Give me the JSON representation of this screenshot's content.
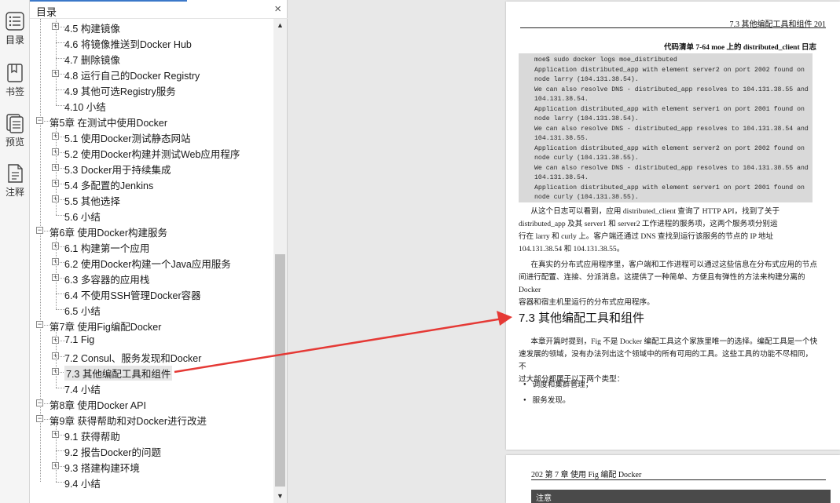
{
  "rail": {
    "items": [
      {
        "label": "目录",
        "icon": "toc-list-icon"
      },
      {
        "label": "书签",
        "icon": "bookmark-icon"
      },
      {
        "label": "预览",
        "icon": "preview-pages-icon"
      },
      {
        "label": "注释",
        "icon": "annotation-icon"
      }
    ]
  },
  "toc": {
    "title": "目录",
    "close": "×",
    "items": [
      {
        "text": "4.5 构建镜像",
        "level": 2,
        "expandable": true
      },
      {
        "text": "4.6 将镜像推送到Docker Hub",
        "level": 2,
        "expandable": false
      },
      {
        "text": "4.7 删除镜像",
        "level": 2,
        "expandable": false
      },
      {
        "text": "4.8 运行自己的Docker Registry",
        "level": 2,
        "expandable": true
      },
      {
        "text": "4.9 其他可选Registry服务",
        "level": 2,
        "expandable": false
      },
      {
        "text": "4.10 小结",
        "level": 2,
        "expandable": false
      },
      {
        "text": "第5章 在测试中使用Docker",
        "level": 1,
        "expandable": true
      },
      {
        "text": "5.1 使用Docker测试静态网站",
        "level": 2,
        "expandable": true
      },
      {
        "text": "5.2 使用Docker构建并测试Web应用程序",
        "level": 2,
        "expandable": true
      },
      {
        "text": "5.3 Docker用于持续集成",
        "level": 2,
        "expandable": true
      },
      {
        "text": "5.4 多配置的Jenkins",
        "level": 2,
        "expandable": true
      },
      {
        "text": "5.5 其他选择",
        "level": 2,
        "expandable": true
      },
      {
        "text": "5.6 小结",
        "level": 2,
        "expandable": false
      },
      {
        "text": "第6章 使用Docker构建服务",
        "level": 1,
        "expandable": true
      },
      {
        "text": "6.1 构建第一个应用",
        "level": 2,
        "expandable": true
      },
      {
        "text": "6.2 使用Docker构建一个Java应用服务",
        "level": 2,
        "expandable": true
      },
      {
        "text": "6.3 多容器的应用栈",
        "level": 2,
        "expandable": true
      },
      {
        "text": "6.4 不使用SSH管理Docker容器",
        "level": 2,
        "expandable": false
      },
      {
        "text": "6.5 小结",
        "level": 2,
        "expandable": false
      },
      {
        "text": "第7章 使用Fig编配Docker",
        "level": 1,
        "expandable": true
      },
      {
        "text": "7.1 Fig",
        "level": 2,
        "expandable": true
      },
      {
        "text": "7.2 Consul、服务发现和Docker",
        "level": 2,
        "expandable": true
      },
      {
        "text": "7.3 其他编配工具和组件",
        "level": 2,
        "expandable": true,
        "selected": true
      },
      {
        "text": "7.4 小结",
        "level": 2,
        "expandable": false
      },
      {
        "text": "第8章 使用Docker API",
        "level": 1,
        "expandable": true
      },
      {
        "text": "第9章 获得帮助和对Docker进行改进",
        "level": 1,
        "expandable": true
      },
      {
        "text": "9.1 获得帮助",
        "level": 2,
        "expandable": true
      },
      {
        "text": "9.2 报告Docker的问题",
        "level": 2,
        "expandable": false
      },
      {
        "text": "9.3 搭建构建环境",
        "level": 2,
        "expandable": true
      },
      {
        "text": "9.4 小结",
        "level": 2,
        "expandable": false
      }
    ]
  },
  "doc": {
    "page1": {
      "running_head": "7.3   其他编配工具和组件      201",
      "caption": "代码清单 7-64   moe 上的 distributed_client 日志",
      "code_lines": [
        "moe$ sudo docker logs moe_distributed",
        "Application distributed_app with element server2 on port 2002 found on",
        "node larry (104.131.38.54).",
        "We can also resolve DNS - distributed_app resolves to 104.131.38.55 and",
        "104.131.38.54.",
        "Application distributed_app with element server1 on port 2001 found on",
        "node larry (104.131.38.54).",
        "We can also resolve DNS - distributed_app resolves to 104.131.38.54 and",
        "104.131.38.55.",
        "Application distributed_app with element server2 on port 2002 found on",
        "node curly (104.131.38.55).",
        "We can also resolve DNS - distributed_app resolves to 104.131.38.55 and",
        "104.131.38.54.",
        "Application distributed_app with element server1 on port 2001 found on",
        "node curly (104.131.38.55)."
      ],
      "para1_lines": [
        "从这个日志可以看到，应用 distributed_client 查询了 HTTP API，找到了关于",
        "distributed_app 及其 server1 和 server2 工作进程的服务项，这两个服务项分别运",
        "行在 larry 和 curly 上。客户端还通过 DNS 查找到运行该服务的节点的 IP 地址",
        "104.131.38.54 和 104.131.38.55。"
      ],
      "para2_lines": [
        "在真实的分布式应用程序里，客户端和工作进程可以通过这些信息在分布式应用的节点",
        "间进行配置、连接、分派消息。这提供了一种简单、方便且有弹性的方法来构建分离的 Docker",
        "容器和宿主机里运行的分布式应用程序。"
      ],
      "heading": "7.3   其他编配工具和组件",
      "para3_lines": [
        "本章开篇时提到，Fig 不是 Docker 编配工具这个家族里唯一的选择。编配工具是一个快",
        "速发展的领域，没有办法列出这个领域中的所有可用的工具。这些工具的功能不尽相同，不",
        "过大部分都属于以下两个类型："
      ],
      "bullets": [
        "调度和集群管理；",
        "服务发现。"
      ]
    },
    "page2": {
      "running_head": "202      第 7 章   使用 Fig 编配 Docker",
      "note": "注意"
    }
  },
  "colors": {
    "arrow": "#e53935",
    "accent": "#3b78c9"
  }
}
